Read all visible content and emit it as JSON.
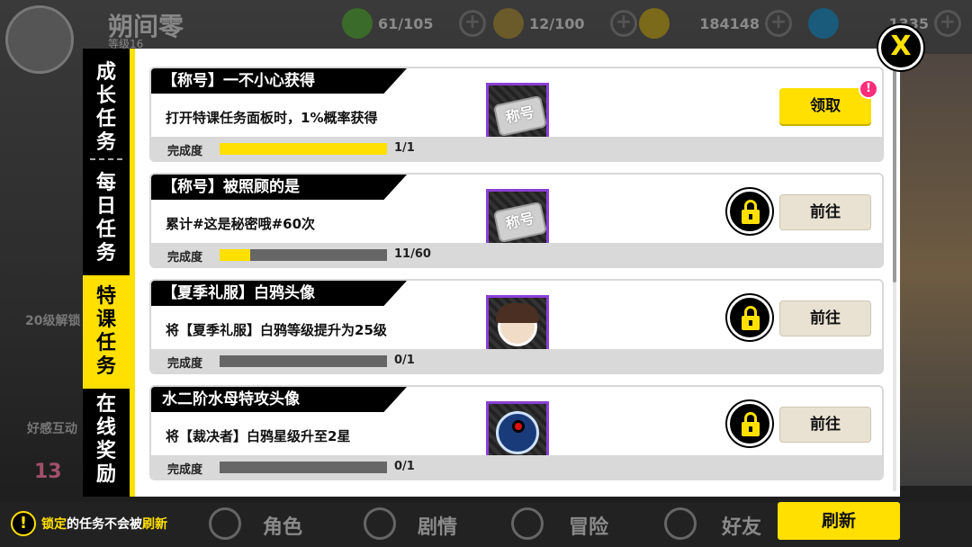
{
  "header": {
    "player_name": "朔间零",
    "player_level": "等级16",
    "stamina": "61/105",
    "tickets": "12/100",
    "gold": "184148",
    "gems": "1335"
  },
  "side_deco": {
    "level_unlock": "20级解锁",
    "affection": "好感互动",
    "badge_number": "13"
  },
  "tabs": [
    {
      "label": "成长任务",
      "active": false
    },
    {
      "label": "每日任务",
      "active": false
    },
    {
      "label": "特课任务",
      "active": true
    },
    {
      "label": "在线奖励",
      "active": false
    }
  ],
  "tasks": [
    {
      "title": "【称号】一不小心获得",
      "desc": "打开特课任务面板时，1%概率获得",
      "progress_label": "完成度",
      "progress": "1/1",
      "fill": 1.0,
      "reward": "称号",
      "action": "领取",
      "state": "claim"
    },
    {
      "title": "【称号】被照顾的是",
      "desc": "累计#这是秘密哦#60次",
      "progress_label": "完成度",
      "progress": "11/60",
      "fill": 0.183,
      "reward": "称号",
      "action": "前往",
      "state": "locked"
    },
    {
      "title": "【夏季礼服】白鸦头像",
      "desc": "将【夏季礼服】白鸦等级提升为25级",
      "progress_label": "完成度",
      "progress": "0/1",
      "fill": 0,
      "reward": "avatar",
      "action": "前往",
      "state": "locked"
    },
    {
      "title": "水二阶水母特攻头像",
      "desc": "将【裁决者】白鸦星级升至2星",
      "progress_label": "完成度",
      "progress": "0/1",
      "fill": 0,
      "reward": "jelly",
      "action": "前往",
      "state": "locked"
    }
  ],
  "notice_mark": "!",
  "close_label": "X",
  "bottom_nav": [
    "角色",
    "剧情",
    "冒险",
    "好友"
  ],
  "hint": {
    "pre": "",
    "lock_word": "锁定",
    "mid": "的任务不会被",
    "refresh_word": "刷新",
    "icon": "!"
  },
  "refresh_label": "刷新",
  "colors": {
    "accent": "#ffe000",
    "reward_border": "#8b3fd6",
    "notice": "#ff2d7a"
  }
}
